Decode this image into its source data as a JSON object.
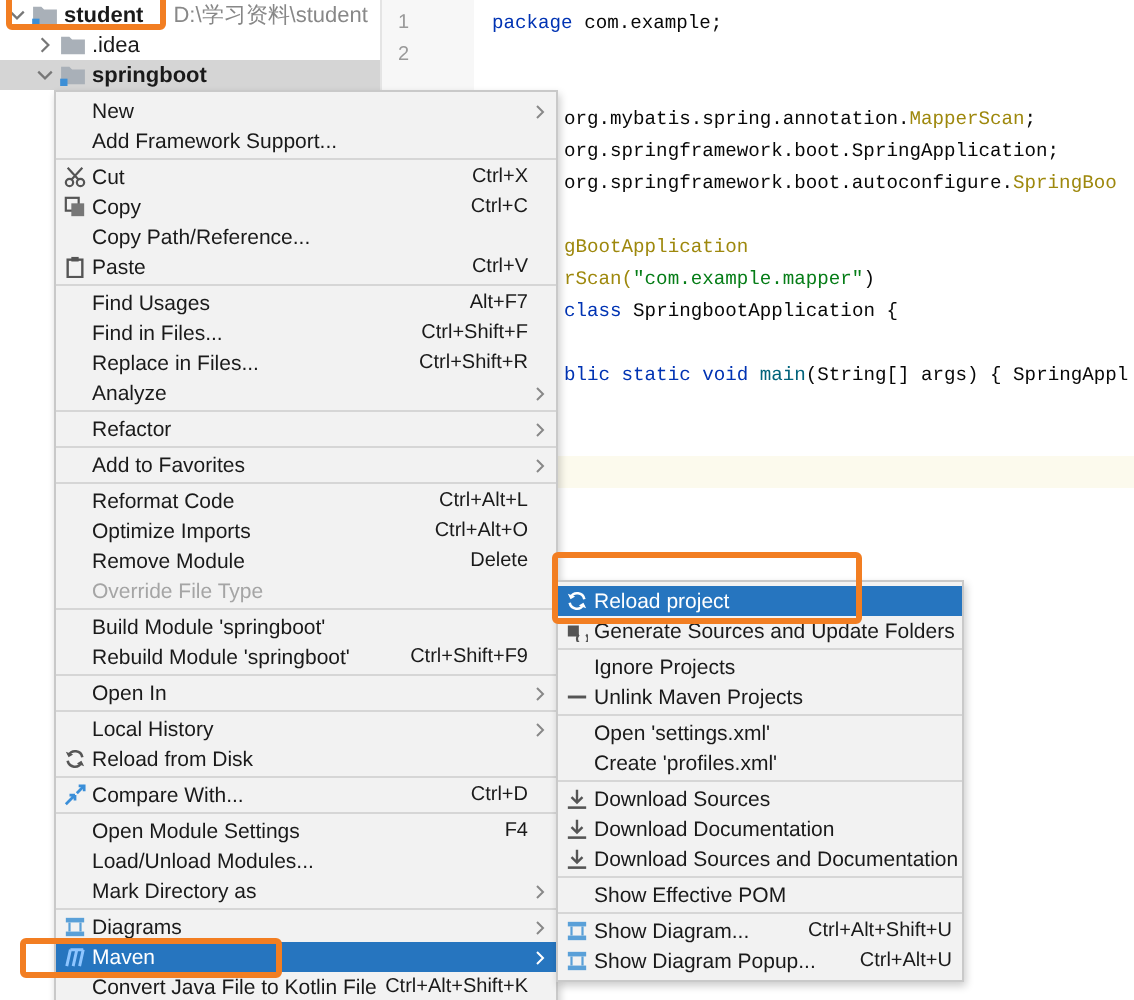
{
  "project_tree": [
    {
      "label": "student",
      "path": "D:\\学习资料\\student",
      "expanded": true,
      "selected": false,
      "kind": "root"
    },
    {
      "label": ".idea",
      "expanded": false,
      "selected": false,
      "kind": "folder"
    },
    {
      "label": "springboot",
      "expanded": true,
      "selected": true,
      "kind": "module"
    }
  ],
  "editor": {
    "lines": [
      {
        "number": "1",
        "current": false,
        "tokens": [
          {
            "text": "package",
            "kind": "keyword"
          },
          {
            "text": " com.example;",
            "kind": "plain"
          }
        ]
      },
      {
        "number": "2",
        "current": false
      },
      {
        "current": false
      },
      {
        "current": false,
        "tokens": [
          {
            "text": "org.mybatis.spring.annotation.",
            "kind": "plain"
          },
          {
            "text": "MapperScan",
            "kind": "annotation"
          },
          {
            "text": ";",
            "kind": "plain"
          }
        ]
      },
      {
        "current": false,
        "tokens": [
          {
            "text": "org.springframework.boot.SpringApplication;",
            "kind": "plain"
          }
        ]
      },
      {
        "current": false,
        "tokens": [
          {
            "text": "org.springframework.boot.autoconfigure.",
            "kind": "plain"
          },
          {
            "text": "SpringBoo",
            "kind": "annotation"
          }
        ]
      },
      {
        "current": false
      },
      {
        "current": false,
        "tokens": [
          {
            "text": "gBootApplication",
            "kind": "annotation"
          }
        ]
      },
      {
        "current": false,
        "tokens": [
          {
            "text": "rScan(",
            "kind": "annotation"
          },
          {
            "text": "\"com.example.mapper\"",
            "kind": "string"
          },
          {
            "text": ")",
            "kind": "plain"
          }
        ]
      },
      {
        "current": false,
        "tokens": [
          {
            "text": "class",
            "kind": "keyword"
          },
          {
            "text": " SpringbootApplication {",
            "kind": "plain"
          }
        ]
      },
      {
        "current": false
      },
      {
        "current": false,
        "tokens": [
          {
            "text": "blic static void",
            "kind": "keyword"
          },
          {
            "text": " main",
            "kind": "method"
          },
          {
            "text": "(String[] args) { SpringAppl",
            "kind": "plain"
          }
        ]
      },
      {
        "current": false
      },
      {
        "current": false
      },
      {
        "current": true
      }
    ]
  },
  "context_menu": {
    "groups": [
      [
        {
          "label": "New",
          "submenu": true,
          "selected": false,
          "disabled": false
        },
        {
          "label": "Add Framework Support...",
          "submenu": false,
          "selected": false,
          "disabled": false
        }
      ],
      [
        {
          "label": "Cut",
          "shortcut": "Ctrl+X",
          "submenu": false,
          "selected": false,
          "disabled": false
        },
        {
          "label": "Copy",
          "shortcut": "Ctrl+C",
          "submenu": false,
          "selected": false,
          "disabled": false
        },
        {
          "label": "Copy Path/Reference...",
          "submenu": false,
          "selected": false,
          "disabled": false
        },
        {
          "label": "Paste",
          "shortcut": "Ctrl+V",
          "submenu": false,
          "selected": false,
          "disabled": false
        }
      ],
      [
        {
          "label": "Find Usages",
          "shortcut": "Alt+F7",
          "submenu": false,
          "selected": false,
          "disabled": false
        },
        {
          "label": "Find in Files...",
          "shortcut": "Ctrl+Shift+F",
          "submenu": false,
          "selected": false,
          "disabled": false
        },
        {
          "label": "Replace in Files...",
          "shortcut": "Ctrl+Shift+R",
          "submenu": false,
          "selected": false,
          "disabled": false
        },
        {
          "label": "Analyze",
          "submenu": true,
          "selected": false,
          "disabled": false
        }
      ],
      [
        {
          "label": "Refactor",
          "submenu": true,
          "selected": false,
          "disabled": false
        }
      ],
      [
        {
          "label": "Add to Favorites",
          "submenu": true,
          "selected": false,
          "disabled": false
        }
      ],
      [
        {
          "label": "Reformat Code",
          "shortcut": "Ctrl+Alt+L",
          "submenu": false,
          "selected": false,
          "disabled": false
        },
        {
          "label": "Optimize Imports",
          "shortcut": "Ctrl+Alt+O",
          "submenu": false,
          "selected": false,
          "disabled": false
        },
        {
          "label": "Remove Module",
          "shortcut": "Delete",
          "submenu": false,
          "selected": false,
          "disabled": false
        },
        {
          "label": "Override File Type",
          "submenu": false,
          "selected": false,
          "disabled": true
        }
      ],
      [
        {
          "label": "Build Module 'springboot'",
          "submenu": false,
          "selected": false,
          "disabled": false
        },
        {
          "label": "Rebuild Module 'springboot'",
          "shortcut": "Ctrl+Shift+F9",
          "submenu": false,
          "selected": false,
          "disabled": false
        }
      ],
      [
        {
          "label": "Open In",
          "submenu": true,
          "selected": false,
          "disabled": false
        }
      ],
      [
        {
          "label": "Local History",
          "submenu": true,
          "selected": false,
          "disabled": false
        },
        {
          "label": "Reload from Disk",
          "submenu": false,
          "selected": false,
          "disabled": false
        }
      ],
      [
        {
          "label": "Compare With...",
          "shortcut": "Ctrl+D",
          "submenu": false,
          "selected": false,
          "disabled": false
        }
      ],
      [
        {
          "label": "Open Module Settings",
          "shortcut": "F4",
          "submenu": false,
          "selected": false,
          "disabled": false
        },
        {
          "label": "Load/Unload Modules...",
          "submenu": false,
          "selected": false,
          "disabled": false
        },
        {
          "label": "Mark Directory as",
          "submenu": true,
          "selected": false,
          "disabled": false
        }
      ],
      [
        {
          "label": "Diagrams",
          "submenu": true,
          "selected": false,
          "disabled": false
        },
        {
          "label": "Maven",
          "submenu": true,
          "selected": true,
          "disabled": false
        },
        {
          "label": "Convert Java File to Kotlin File",
          "shortcut": "Ctrl+Alt+Shift+K",
          "submenu": false,
          "selected": false,
          "disabled": false
        }
      ]
    ]
  },
  "maven_submenu": {
    "groups": [
      [
        {
          "label": "Reload project",
          "selected": true
        },
        {
          "label": "Generate Sources and Update Folders",
          "selected": false
        }
      ],
      [
        {
          "label": "Ignore Projects",
          "selected": false
        },
        {
          "label": "Unlink Maven Projects",
          "selected": false
        }
      ],
      [
        {
          "label": "Open 'settings.xml'",
          "selected": false
        },
        {
          "label": "Create 'profiles.xml'",
          "selected": false
        }
      ],
      [
        {
          "label": "Download Sources",
          "selected": false
        },
        {
          "label": "Download Documentation",
          "selected": false
        },
        {
          "label": "Download Sources and Documentation",
          "selected": false
        }
      ],
      [
        {
          "label": "Show Effective POM",
          "selected": false
        }
      ],
      [
        {
          "label": "Show Diagram...",
          "shortcut": "Ctrl+Alt+Shift+U",
          "selected": false
        },
        {
          "label": "Show Diagram Popup...",
          "shortcut": "Ctrl+Alt+U",
          "selected": false
        }
      ]
    ]
  }
}
